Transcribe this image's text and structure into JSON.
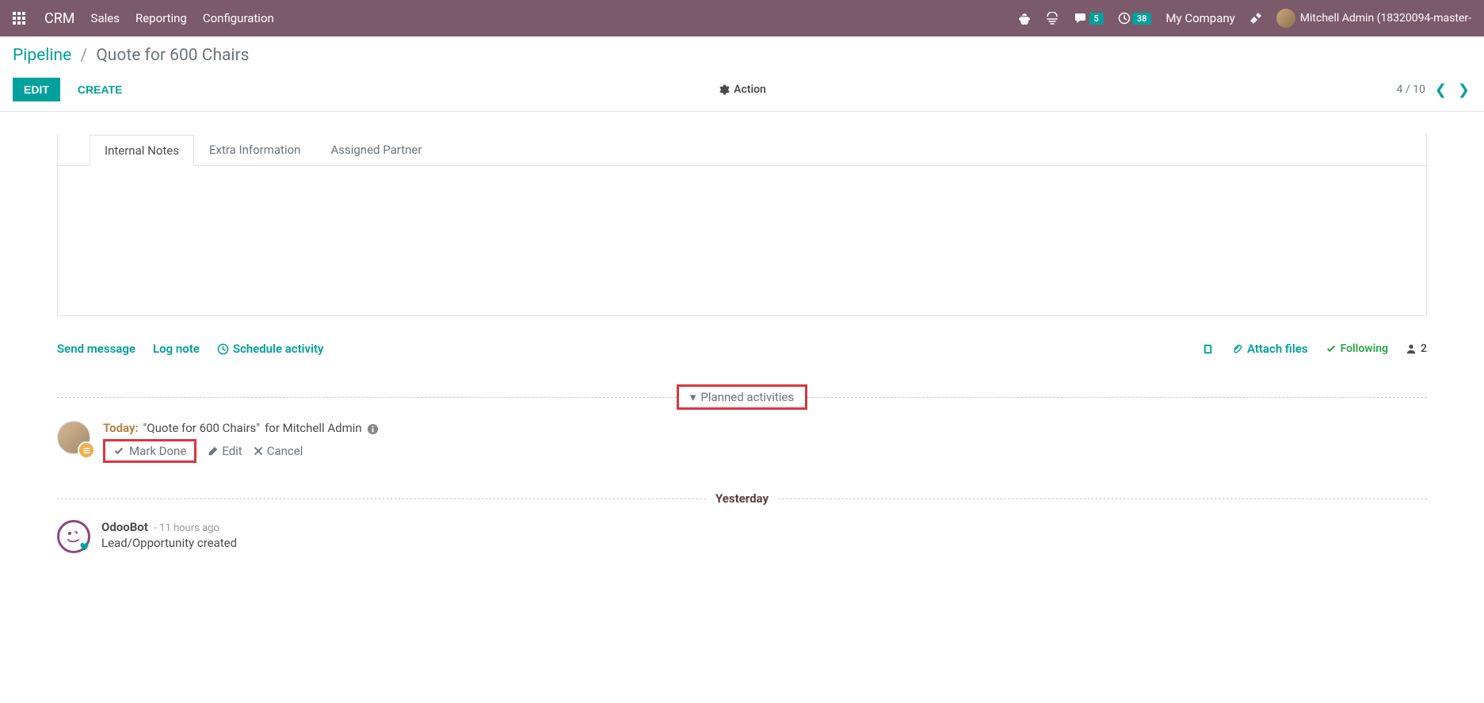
{
  "navbar": {
    "app_name": "CRM",
    "menu": [
      "Sales",
      "Reporting",
      "Configuration"
    ],
    "messages_count": "5",
    "activities_count": "38",
    "company": "My Company",
    "user": "Mitchell Admin (18320094-master-"
  },
  "breadcrumb": {
    "root": "Pipeline",
    "current": "Quote for 600 Chairs"
  },
  "controls": {
    "edit": "EDIT",
    "create": "CREATE",
    "action": "Action",
    "pager": "4 / 10"
  },
  "tabs": [
    "Internal Notes",
    "Extra Information",
    "Assigned Partner"
  ],
  "chatter": {
    "send_message": "Send message",
    "log_note": "Log note",
    "schedule_activity": "Schedule activity",
    "attach_files": "Attach files",
    "following": "Following",
    "followers": "2"
  },
  "planned": {
    "header": "Planned activities",
    "today": "Today:",
    "title": "\"Quote for 600 Chairs\"",
    "for": "for Mitchell Admin",
    "mark_done": "Mark Done",
    "edit": "Edit",
    "cancel": "Cancel"
  },
  "yesterday": {
    "label": "Yesterday",
    "author": "OdooBot",
    "time": "- 11 hours ago",
    "body": "Lead/Opportunity created"
  }
}
